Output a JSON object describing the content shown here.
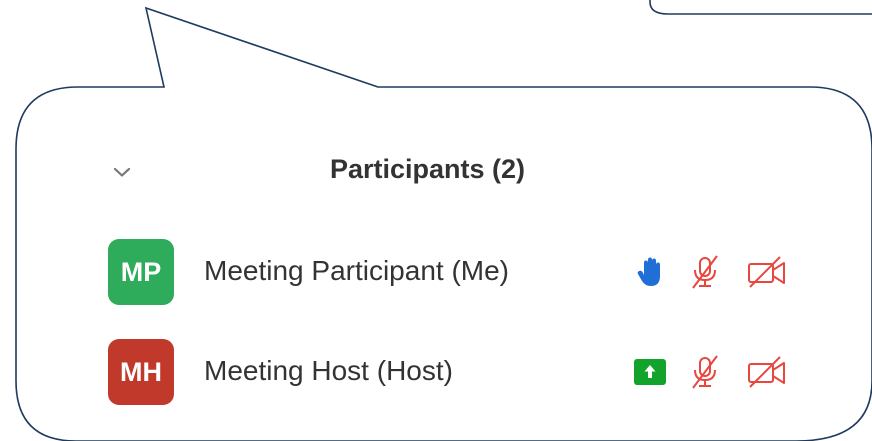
{
  "panel": {
    "title": "Participants (2)",
    "collapse_icon": "chevron-down-icon"
  },
  "participants": [
    {
      "initials": "MP",
      "name": "Meeting Participant (Me)",
      "avatar_color": "#2eab5b",
      "status_icon": "raised-hand-icon",
      "mic_icon": "mic-muted-icon",
      "video_icon": "video-off-icon"
    },
    {
      "initials": "MH",
      "name": "Meeting Host (Host)",
      "avatar_color": "#c0392b",
      "status_icon": "share-screen-icon",
      "mic_icon": "mic-muted-icon",
      "video_icon": "video-off-icon"
    }
  ],
  "colors": {
    "bubble_outline": "#1f3a5f",
    "muted_red": "#e8473f",
    "hand_blue": "#1f6fd6",
    "share_green": "#12a32c",
    "text": "#333333"
  }
}
